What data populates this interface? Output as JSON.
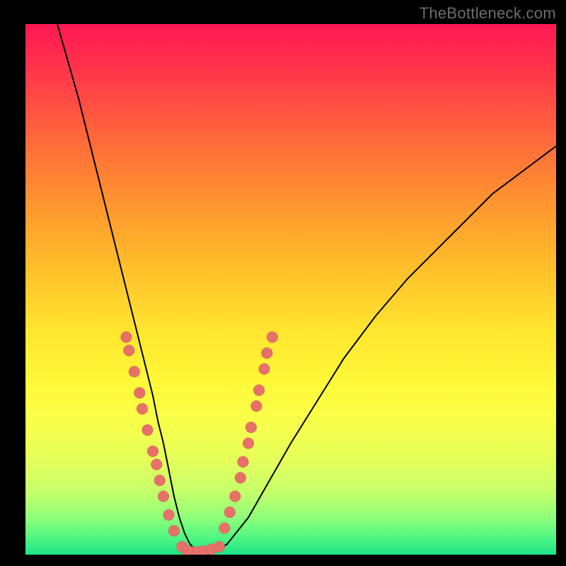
{
  "watermark": "TheBottleneck.com",
  "colors": {
    "frame": "#000000",
    "curve": "#000000",
    "dot": "#e77169",
    "gradient_top": "#ff1753",
    "gradient_bottom": "#1de388"
  },
  "chart_data": {
    "type": "line",
    "title": "",
    "xlabel": "",
    "ylabel": "",
    "xlim": [
      0,
      100
    ],
    "ylim": [
      0,
      100
    ],
    "grid": false,
    "legend": false,
    "annotations": [
      "TheBottleneck.com"
    ],
    "series": [
      {
        "name": "bottleneck-curve",
        "x": [
          6,
          8,
          10,
          12,
          14,
          16,
          18,
          20,
          22,
          24,
          25,
          26,
          27,
          28,
          29,
          30,
          31,
          33,
          35,
          38,
          42,
          46,
          50,
          55,
          60,
          66,
          72,
          80,
          88,
          96,
          100
        ],
        "y": [
          100,
          93,
          86,
          78,
          70,
          62,
          54,
          46,
          38,
          30,
          25,
          21,
          16,
          11,
          7,
          4,
          2,
          0,
          0,
          2,
          7,
          14,
          21,
          29,
          37,
          45,
          52,
          60,
          68,
          74,
          77
        ]
      }
    ],
    "markers": [
      {
        "name": "left-branch-dots",
        "points": [
          {
            "x": 19.0,
            "y": 41.0
          },
          {
            "x": 19.5,
            "y": 38.5
          },
          {
            "x": 20.5,
            "y": 34.5
          },
          {
            "x": 21.5,
            "y": 30.5
          },
          {
            "x": 22.0,
            "y": 27.5
          },
          {
            "x": 23.0,
            "y": 23.5
          },
          {
            "x": 24.0,
            "y": 19.5
          },
          {
            "x": 24.7,
            "y": 17.0
          },
          {
            "x": 25.3,
            "y": 14.0
          },
          {
            "x": 26.0,
            "y": 11.0
          },
          {
            "x": 27.0,
            "y": 7.5
          },
          {
            "x": 28.0,
            "y": 4.5
          }
        ]
      },
      {
        "name": "trough-dots",
        "points": [
          {
            "x": 29.5,
            "y": 1.5
          },
          {
            "x": 30.5,
            "y": 0.7
          },
          {
            "x": 31.5,
            "y": 0.5
          },
          {
            "x": 32.5,
            "y": 0.5
          },
          {
            "x": 33.5,
            "y": 0.7
          },
          {
            "x": 35.0,
            "y": 1.0
          },
          {
            "x": 36.5,
            "y": 1.5
          }
        ]
      },
      {
        "name": "right-branch-dots",
        "points": [
          {
            "x": 37.5,
            "y": 5.0
          },
          {
            "x": 38.5,
            "y": 8.0
          },
          {
            "x": 39.5,
            "y": 11.0
          },
          {
            "x": 40.5,
            "y": 14.5
          },
          {
            "x": 41.0,
            "y": 17.5
          },
          {
            "x": 42.0,
            "y": 21.0
          },
          {
            "x": 42.5,
            "y": 24.0
          },
          {
            "x": 43.5,
            "y": 28.0
          },
          {
            "x": 44.0,
            "y": 31.0
          },
          {
            "x": 45.0,
            "y": 35.0
          },
          {
            "x": 45.5,
            "y": 38.0
          },
          {
            "x": 46.5,
            "y": 41.0
          }
        ]
      }
    ]
  }
}
